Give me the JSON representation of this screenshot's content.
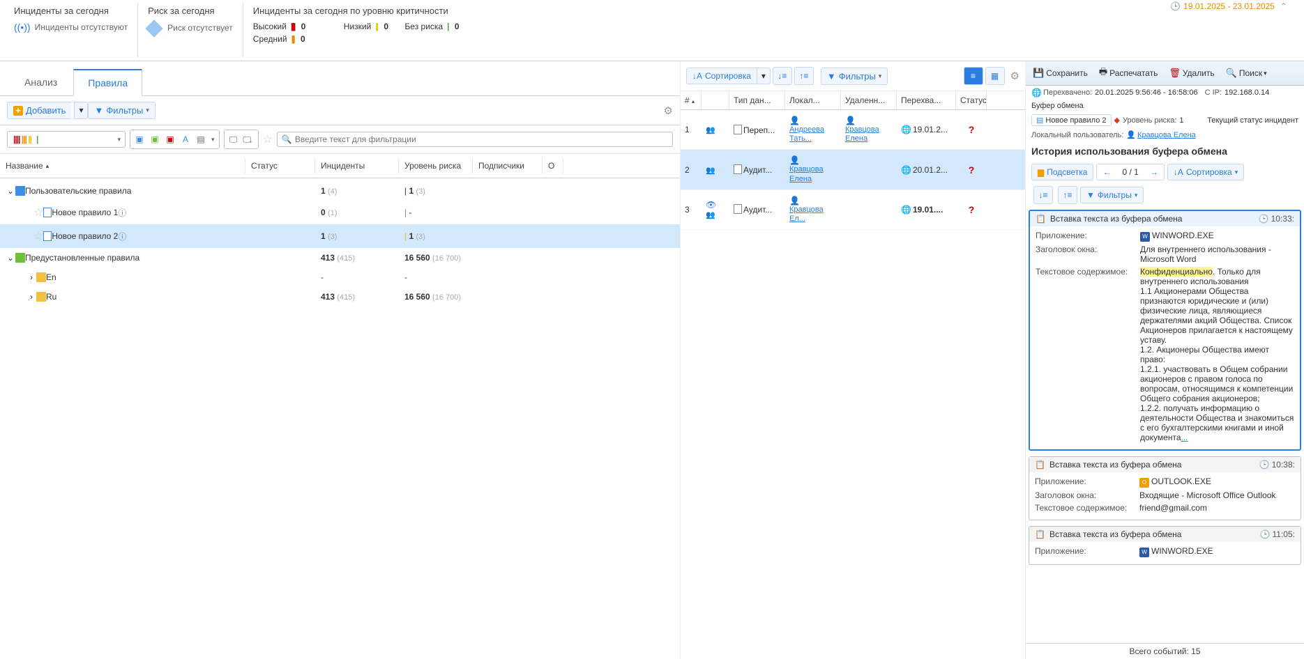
{
  "header": {
    "date_range": "19.01.2025 - 23.01.2025",
    "p1_title": "Инциденты за сегодня",
    "p1_text": "Инциденты отсутствуют",
    "p2_title": "Риск за сегодня",
    "p2_text": "Риск отсутствует",
    "p3_title": "Инциденты за сегодня по уровню критичности",
    "crit_high": "Высокий",
    "crit_high_v": "0",
    "crit_med": "Средний",
    "crit_med_v": "0",
    "crit_low": "Низкий",
    "crit_low_v": "0",
    "crit_nor": "Без риска",
    "crit_nor_v": "0"
  },
  "left": {
    "tab_analysis": "Анализ",
    "tab_rules": "Правила",
    "add_label": "Добавить",
    "filter_label": "Фильтры",
    "search_placeholder": "Введите текст для фильтрации",
    "cols": {
      "name": "Название",
      "status": "Статус",
      "inc": "Инциденты",
      "risk": "Уровень риска",
      "sub": "Подписчики",
      "o": "О"
    },
    "tree": {
      "user_rules": "Пользовательские правила",
      "user_rules_inc": "1",
      "user_rules_inc_s": "(4)",
      "user_rules_risk": "1",
      "user_rules_risk_s": "(3)",
      "r1": "Новое правило 1",
      "r1_inc": "0",
      "r1_inc_s": "(1)",
      "r1_risk": "-",
      "r2": "Новое правило 2",
      "r2_inc": "1",
      "r2_inc_s": "(3)",
      "r2_risk": "1",
      "r2_risk_s": "(3)",
      "preset": "Предустановленные правила",
      "preset_inc": "413",
      "preset_inc_s": "(415)",
      "preset_risk": "16 560",
      "preset_risk_s": "(16 700)",
      "en": "En",
      "en_inc": "-",
      "en_risk": "-",
      "ru": "Ru",
      "ru_inc": "413",
      "ru_inc_s": "(415)",
      "ru_risk": "16 560",
      "ru_risk_s": "(16 700)"
    }
  },
  "mid": {
    "sort": "Сортировка",
    "filter": "Фильтры",
    "cols": {
      "n": "#",
      "type": "Тип дан...",
      "local": "Локал...",
      "del": "Удаленн...",
      "int": "Перехва...",
      "st": "Статус"
    },
    "r1": {
      "n": "1",
      "type": "Переп...",
      "local": "Андреева Тать...",
      "del": "Кравцова Елена",
      "int": "19.01.2..."
    },
    "r2": {
      "n": "2",
      "type": "Аудит...",
      "local": "Кравцова Елена",
      "del": "",
      "int": "20.01.2..."
    },
    "r3": {
      "n": "3",
      "type": "Аудит...",
      "local": "Кравцова Ел...",
      "del": "",
      "int": "19.01...."
    }
  },
  "right": {
    "save": "Сохранить",
    "print": "Распечатать",
    "del": "Удалить",
    "search": "Поиск",
    "intercepted_label": "Перехвачено:",
    "intercepted_val": "20.01.2025 9:56:46 - 16:58:06",
    "ip_label": "С IP:",
    "ip_val": "192.168.0.14",
    "channel": "Буфер обмена",
    "rule": "Новое правило 2",
    "risk_label": "Уровень риска:",
    "risk_val": "1",
    "status_label": "Текущий статус инцидент",
    "local_user_label": "Локальный пользователь:",
    "local_user": "Кравцова Елена",
    "title": "История использования буфера обмена",
    "highlight": "Подсветка",
    "page_cur": "0",
    "page_total": "/ 1",
    "sort": "Сортировка",
    "filters": "Фильтры",
    "card1": {
      "title": "Вставка текста из буфера обмена",
      "time": "10:33:",
      "app_label": "Приложение:",
      "app": "WINWORD.EXE",
      "win_label": "Заголовок окна:",
      "win": "Для внутреннего использования - Microsoft Word",
      "txt_label": "Текстовое содержимое:",
      "txt_hl": "Конфиденциально",
      "txt_rest": ". Только для внутреннего использования\n1.1       Акционерами Общества признаются юридические и (или) физические лица, являющиеся держателями акций Общества. Список Акционеров прилагается к настоящему уставу.\n1.2.      Акционеры Общества имеют право:\n1.2.1.    участвовать в Общем собрании акционеров с правом голоса по вопросам, относящимся к компетенции Общего собрания акционеров;\n1.2.2.    получать информацию о деятельности Общества и знакомиться с его бухгалтерскими книгами и иной документа"
    },
    "card2": {
      "title": "Вставка текста из буфера обмена",
      "time": "10:38:",
      "app_label": "Приложение:",
      "app": "OUTLOOK.EXE",
      "win_label": "Заголовок окна:",
      "win": "Входящие - Microsoft Office Outlook",
      "txt_label": "Текстовое содержимое:",
      "txt": "friend@gmail.com"
    },
    "card3": {
      "title": "Вставка текста из буфера обмена",
      "time": "11:05:",
      "app_label": "Приложение:",
      "app": "WINWORD.EXE"
    },
    "footer_label": "Всего событий:",
    "footer_val": "15"
  }
}
